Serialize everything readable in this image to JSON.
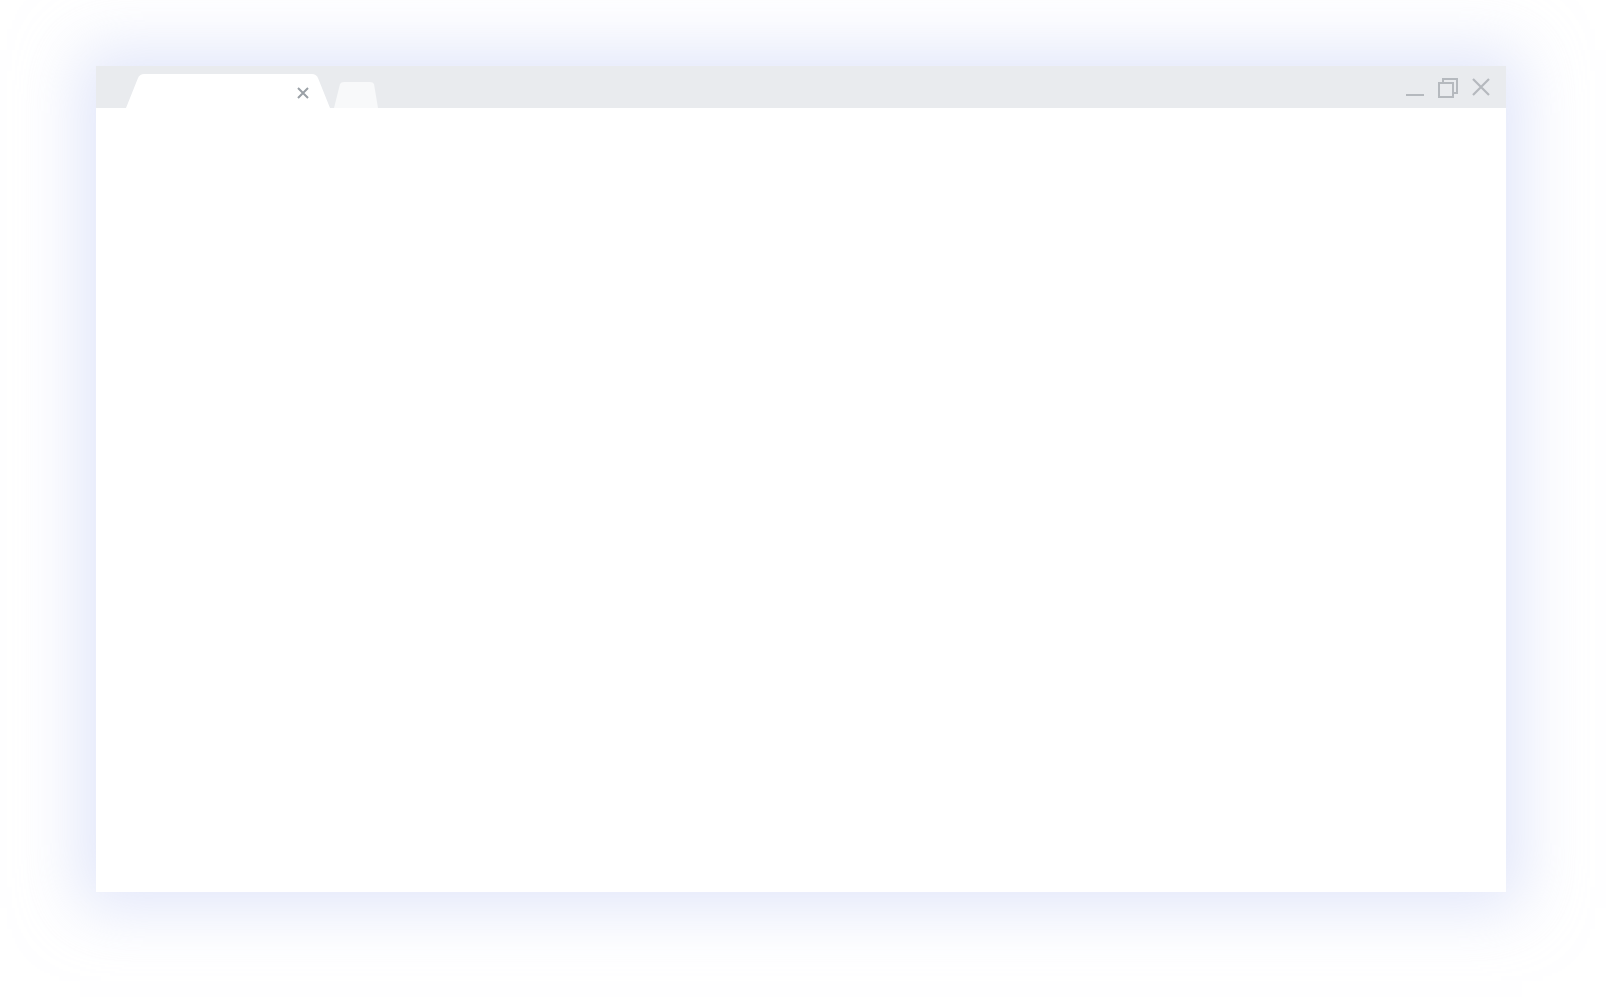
{
  "browser_window": {
    "tabs": [
      {
        "selected": true
      }
    ]
  }
}
